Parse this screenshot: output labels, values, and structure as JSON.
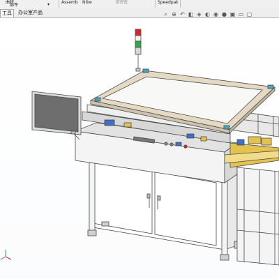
{
  "ribbon": {
    "items": [
      {
        "label": "曲特"
      },
      {
        "label": "部件"
      },
      {
        "label": "Assemb"
      },
      {
        "label": "Nibe"
      },
      {
        "label": "译审查"
      },
      {
        "label": "Speedpak"
      }
    ]
  },
  "tabs": [
    {
      "label": "工具"
    },
    {
      "label": "办公室产品"
    }
  ],
  "hud": {
    "icons": [
      "zoom-to-fit",
      "zoom-area",
      "previous-view",
      "section-view",
      "view-orientation",
      "display-style",
      "hide-show-items",
      "edit-appearance",
      "apply-scene",
      "view-settings",
      "monitor"
    ]
  },
  "colors": {
    "frame_stroke": "#4a4a4a",
    "tan_frame": "#e6d9c4",
    "glass": "#f8f8f7",
    "cyan_corner": "#3fa6c6",
    "yellow_part": "#e4c24d",
    "blue_part": "#3f6fc8",
    "lamp_red": "#d82525",
    "lamp_green": "#2fa84a",
    "monitor_screen": "#6e6e6e"
  }
}
